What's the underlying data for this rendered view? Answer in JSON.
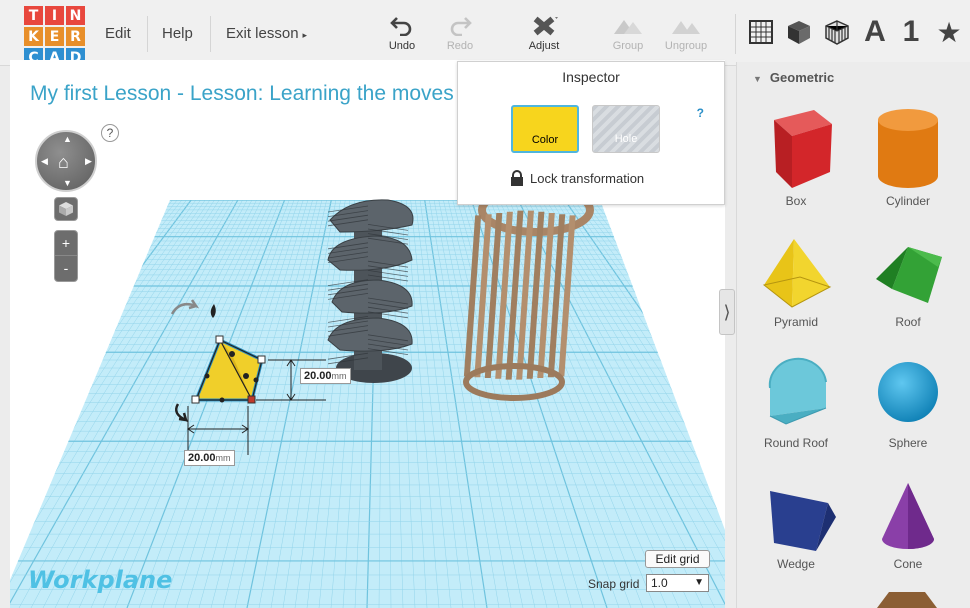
{
  "logo": {
    "letters": [
      "T",
      "I",
      "N",
      "K",
      "E",
      "R",
      "C",
      "A",
      "D"
    ],
    "colors": [
      "#e8473d",
      "#e8473d",
      "#e8473d",
      "#e88f2a",
      "#e88f2a",
      "#e88f2a",
      "#2e8fd1",
      "#2e8fd1",
      "#2e8fd1"
    ]
  },
  "menu": {
    "edit": "Edit",
    "help": "Help",
    "exit": "Exit lesson"
  },
  "toolbar": {
    "undo": "Undo",
    "redo": "Redo",
    "adjust": "Adjust",
    "group": "Group",
    "ungroup": "Ungroup"
  },
  "right_tools": {
    "letter_a": "A",
    "number_1": "1"
  },
  "lesson_title": "My first Lesson - Lesson: Learning the moves",
  "help_q": "?",
  "inspector": {
    "title": "Inspector",
    "help": "?",
    "color_label": "Color",
    "hole_label": "Hole",
    "lock_label": "Lock transformation",
    "color_value": "#f7d51d"
  },
  "dimensions": {
    "height": "20.00",
    "width": "20.00",
    "unit": "mm"
  },
  "workplane_label": "Workplane",
  "panel": {
    "category": "Geometric",
    "shapes": [
      {
        "name": "Box"
      },
      {
        "name": "Cylinder"
      },
      {
        "name": "Pyramid"
      },
      {
        "name": "Roof"
      },
      {
        "name": "Round Roof"
      },
      {
        "name": "Sphere"
      },
      {
        "name": "Wedge"
      },
      {
        "name": "Cone"
      }
    ]
  },
  "grid": {
    "edit_label": "Edit grid",
    "snap_label": "Snap grid",
    "snap_value": "1.0"
  }
}
